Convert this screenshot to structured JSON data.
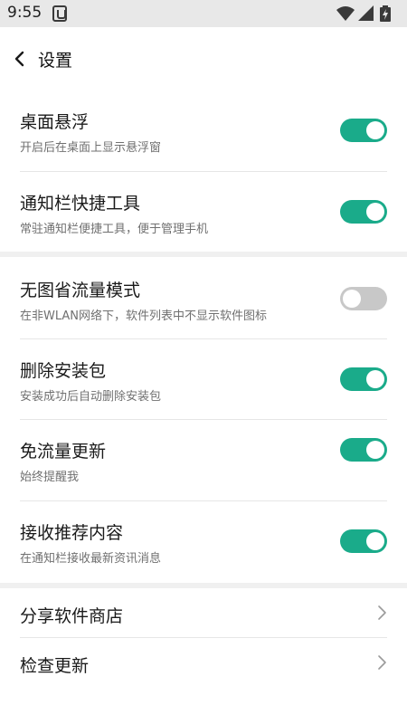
{
  "status_bar": {
    "time": "9:55"
  },
  "header": {
    "title": "设置"
  },
  "settings": [
    {
      "title": "桌面悬浮",
      "subtitle": "开启后在桌面上显示悬浮窗",
      "enabled": true
    },
    {
      "title": "通知栏快捷工具",
      "subtitle": "常驻通知栏便捷工具，便于管理手机",
      "enabled": true
    },
    {
      "title": "无图省流量模式",
      "subtitle": "在非WLAN网络下，软件列表中不显示软件图标",
      "enabled": false
    },
    {
      "title": "删除安装包",
      "subtitle": "安装成功后自动删除安装包",
      "enabled": true
    },
    {
      "title": "免流量更新",
      "subtitle": "始终提醒我",
      "enabled": true
    },
    {
      "title": "接收推荐内容",
      "subtitle": "在通知栏接收最新资讯消息",
      "enabled": true
    }
  ],
  "links": [
    {
      "label": "分享软件商店"
    },
    {
      "label": "检查更新"
    }
  ],
  "colors": {
    "toggle_on": "#1aab8a",
    "toggle_off": "#c8c8c8",
    "divider": "#e6e6e6"
  }
}
